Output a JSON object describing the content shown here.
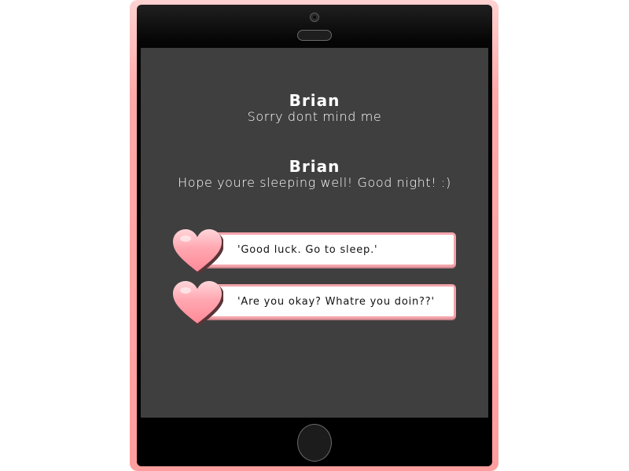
{
  "messages": [
    {
      "sender": "Brian",
      "text": "Sorry dont mind me"
    },
    {
      "sender": "Brian",
      "text": "Hope youre sleeping well! Good night! :)"
    }
  ],
  "choices": [
    {
      "label": "'Good luck. Go to sleep.'"
    },
    {
      "label": "'Are you okay? Whatre you doin??'"
    }
  ],
  "colors": {
    "phone_case": "#ff9e9e",
    "screen_background": "#3f3f3f",
    "choice_border": "#f4a4ab",
    "heart": "#ff9aa6"
  }
}
